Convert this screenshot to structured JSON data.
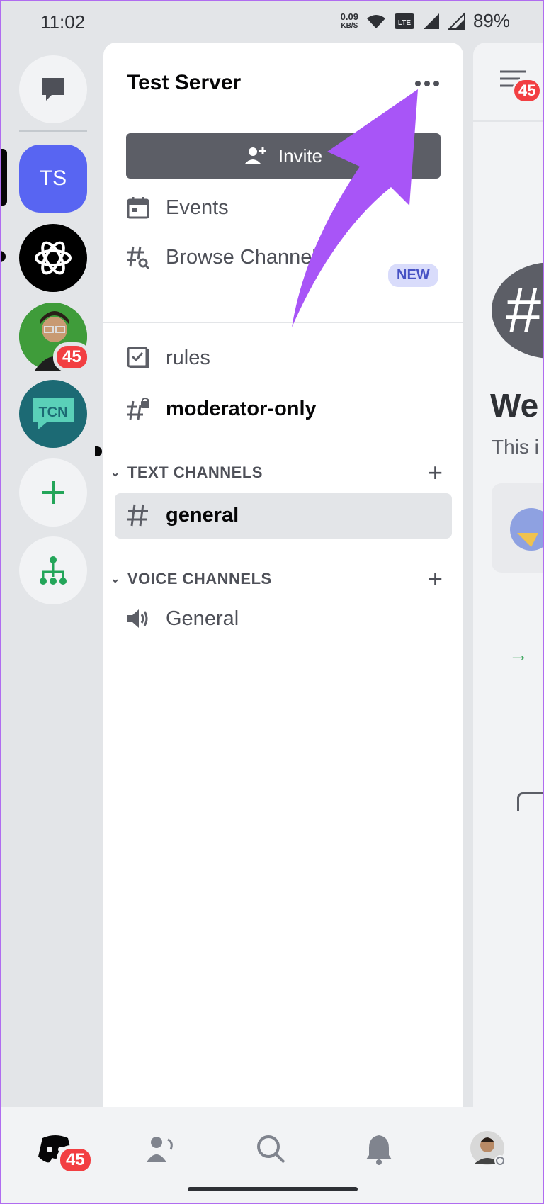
{
  "status": {
    "time": "11:02",
    "net_speed": "0.09",
    "net_unit": "KB/S",
    "lte": "Vo LTE",
    "battery": "89%"
  },
  "rail": {
    "ts_label": "TS",
    "tcn_label": "TCN",
    "avatar_badge": "45"
  },
  "server": {
    "name": "Test Server",
    "invite_label": "Invite"
  },
  "menu": {
    "events": "Events",
    "browse": "Browse Channels",
    "browse_badge": "NEW"
  },
  "channels": {
    "top": [
      {
        "name": "rules"
      },
      {
        "name": "moderator-only"
      }
    ],
    "text_category": "TEXT CHANNELS",
    "text": [
      {
        "name": "general"
      }
    ],
    "voice_category": "VOICE CHANNELS",
    "voice": [
      {
        "name": "General"
      }
    ]
  },
  "right": {
    "badge": "45",
    "hash": "#",
    "title": "We",
    "subtitle": "This i"
  },
  "nav": {
    "home_badge": "45"
  },
  "colors": {
    "blurple": "#5865f2",
    "red": "#f23f42",
    "green": "#23a559",
    "annotation": "#a855f7"
  }
}
